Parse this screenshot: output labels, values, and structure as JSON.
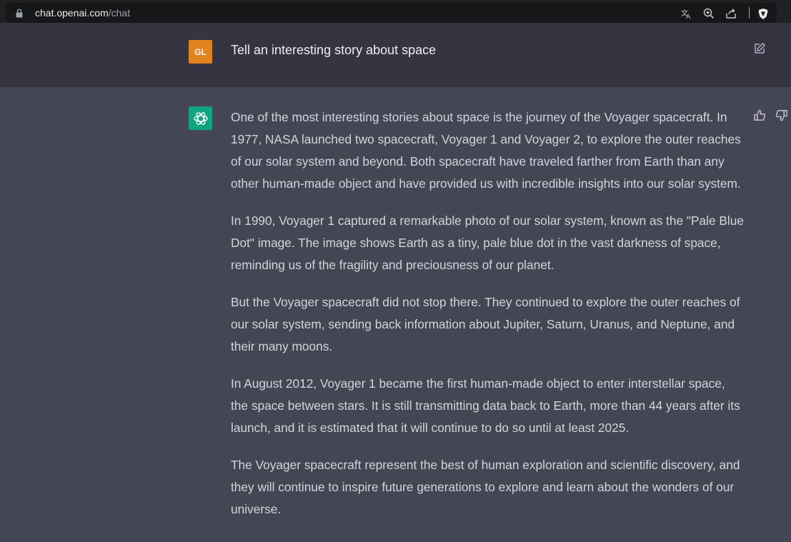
{
  "browser": {
    "url_host": "chat.openai.com",
    "url_path": "/chat",
    "icons": [
      "lock-icon",
      "translate-icon",
      "zoom-icon",
      "share-icon",
      "brave-shield-icon"
    ]
  },
  "user": {
    "initials": "GL",
    "prompt": "Tell an interesting story about space"
  },
  "assistant": {
    "paragraphs": [
      "One of the most interesting stories about space is the journey of the Voyager spacecraft. In 1977, NASA launched two spacecraft, Voyager 1 and Voyager 2, to explore the outer reaches of our solar system and beyond. Both spacecraft have traveled farther from Earth than any other human-made object and have provided us with incredible insights into our solar system.",
      "In 1990, Voyager 1 captured a remarkable photo of our solar system, known as the \"Pale Blue Dot\" image. The image shows Earth as a tiny, pale blue dot in the vast darkness of space, reminding us of the fragility and preciousness of our planet.",
      "But the Voyager spacecraft did not stop there. They continued to explore the outer reaches of our solar system, sending back information about Jupiter, Saturn, Uranus, and Neptune, and their many moons.",
      "In August 2012, Voyager 1 became the first human-made object to enter interstellar space, the space between stars. It is still transmitting data back to Earth, more than 44 years after its launch, and it is estimated that it will continue to do so until at least 2025.",
      "The Voyager spacecraft represent the best of human exploration and scientific discovery, and they will continue to inspire future generations to explore and learn about the wonders of our universe."
    ]
  },
  "colors": {
    "avatar_bg": "#e3831f",
    "gpt_bg": "#10a37f",
    "user_row_bg": "#343541",
    "ai_row_bg": "#444654"
  }
}
